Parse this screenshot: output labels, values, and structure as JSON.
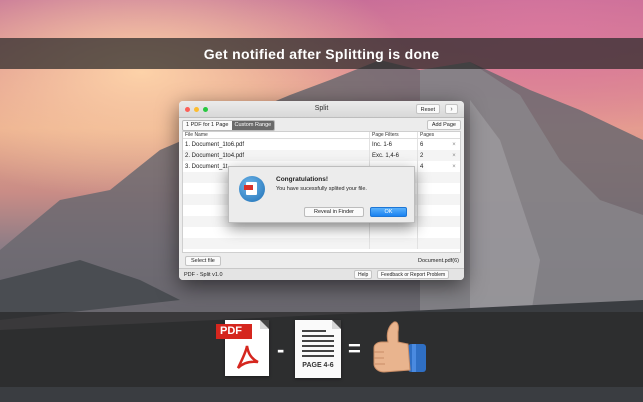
{
  "banner": {
    "headline": "Get notified after Splitting is done"
  },
  "window": {
    "title": "Split",
    "reset_label": "Reset",
    "arrow_label": "›",
    "tabs": [
      {
        "label": "1 PDF for 1 Page",
        "active": false
      },
      {
        "label": "Custom Range",
        "active": true
      }
    ],
    "add_page_label": "Add Page",
    "columns": {
      "file_name": "File Name",
      "page_filters": "Page Filters",
      "pages": "Pages"
    },
    "rows": [
      {
        "file": "1. Document_1to6.pdf",
        "filter": "Inc. 1-6",
        "pages": "6"
      },
      {
        "file": "2. Document_1to4.pdf",
        "filter": "Exc. 1,4-6",
        "pages": "2"
      },
      {
        "file": "3. Document_1t",
        "filter": "",
        "pages": "4"
      }
    ],
    "remove_icon": "×",
    "select_file_label": "Select file",
    "document_name": "Document.pdf(6)",
    "version": "PDF - Split v1.0",
    "help_label": "Help",
    "feedback_label": "Feedback or Report Problem"
  },
  "alert": {
    "title": "Congratulations!",
    "message": "You have sucessfully splited your file.",
    "reveal_label": "Reveal in Finder",
    "ok_label": "OK",
    "icon": "pdf-split-app-icon"
  },
  "illustration": {
    "pdf_label": "PDF",
    "minus": "-",
    "page_label": "PAGE 4-6",
    "equals": "=",
    "result_icon": "thumbs-up-icon"
  },
  "colors": {
    "ok_button": "#1a82f1",
    "pdf_red": "#d5261e",
    "active_tab": "#6a6a6a"
  }
}
